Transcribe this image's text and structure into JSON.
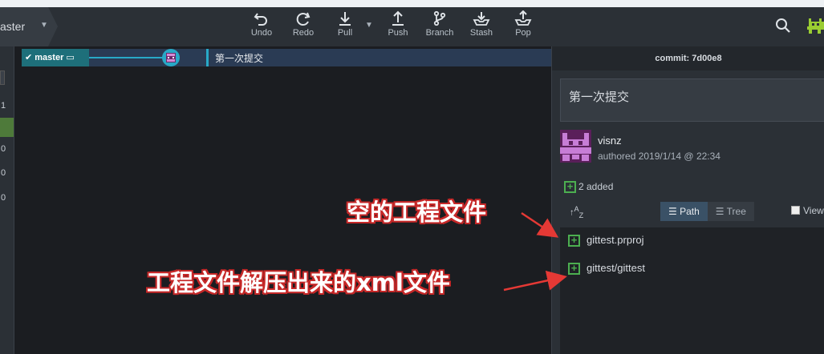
{
  "toolbar": {
    "branch": "aster",
    "buttons": [
      {
        "label": "Undo",
        "icon": "undo-icon"
      },
      {
        "label": "Redo",
        "icon": "redo-icon"
      },
      {
        "label": "Pull",
        "icon": "pull-icon"
      },
      {
        "label": "Push",
        "icon": "push-icon"
      },
      {
        "label": "Branch",
        "icon": "branch-icon"
      },
      {
        "label": "Stash",
        "icon": "stash-icon"
      },
      {
        "label": "Pop",
        "icon": "pop-icon"
      }
    ]
  },
  "left_column": [
    "1",
    "",
    "0",
    "0",
    "0"
  ],
  "graph": {
    "branch_label": "master",
    "commit_message": "第一次提交"
  },
  "details": {
    "commit_header": "commit: 7d00e8",
    "message": "第一次提交",
    "author": "visnz",
    "authored": "authored  2019/1/14 @ 22:34",
    "added": "2 added",
    "view_path": "Path",
    "view_tree": "Tree",
    "view_all": "View",
    "files": [
      "gittest.prproj",
      "gittest/gittest"
    ]
  },
  "annotations": {
    "a1": "空的工程文件",
    "a2": "工程文件解压出来的xml文件",
    "color": "#c62828"
  }
}
